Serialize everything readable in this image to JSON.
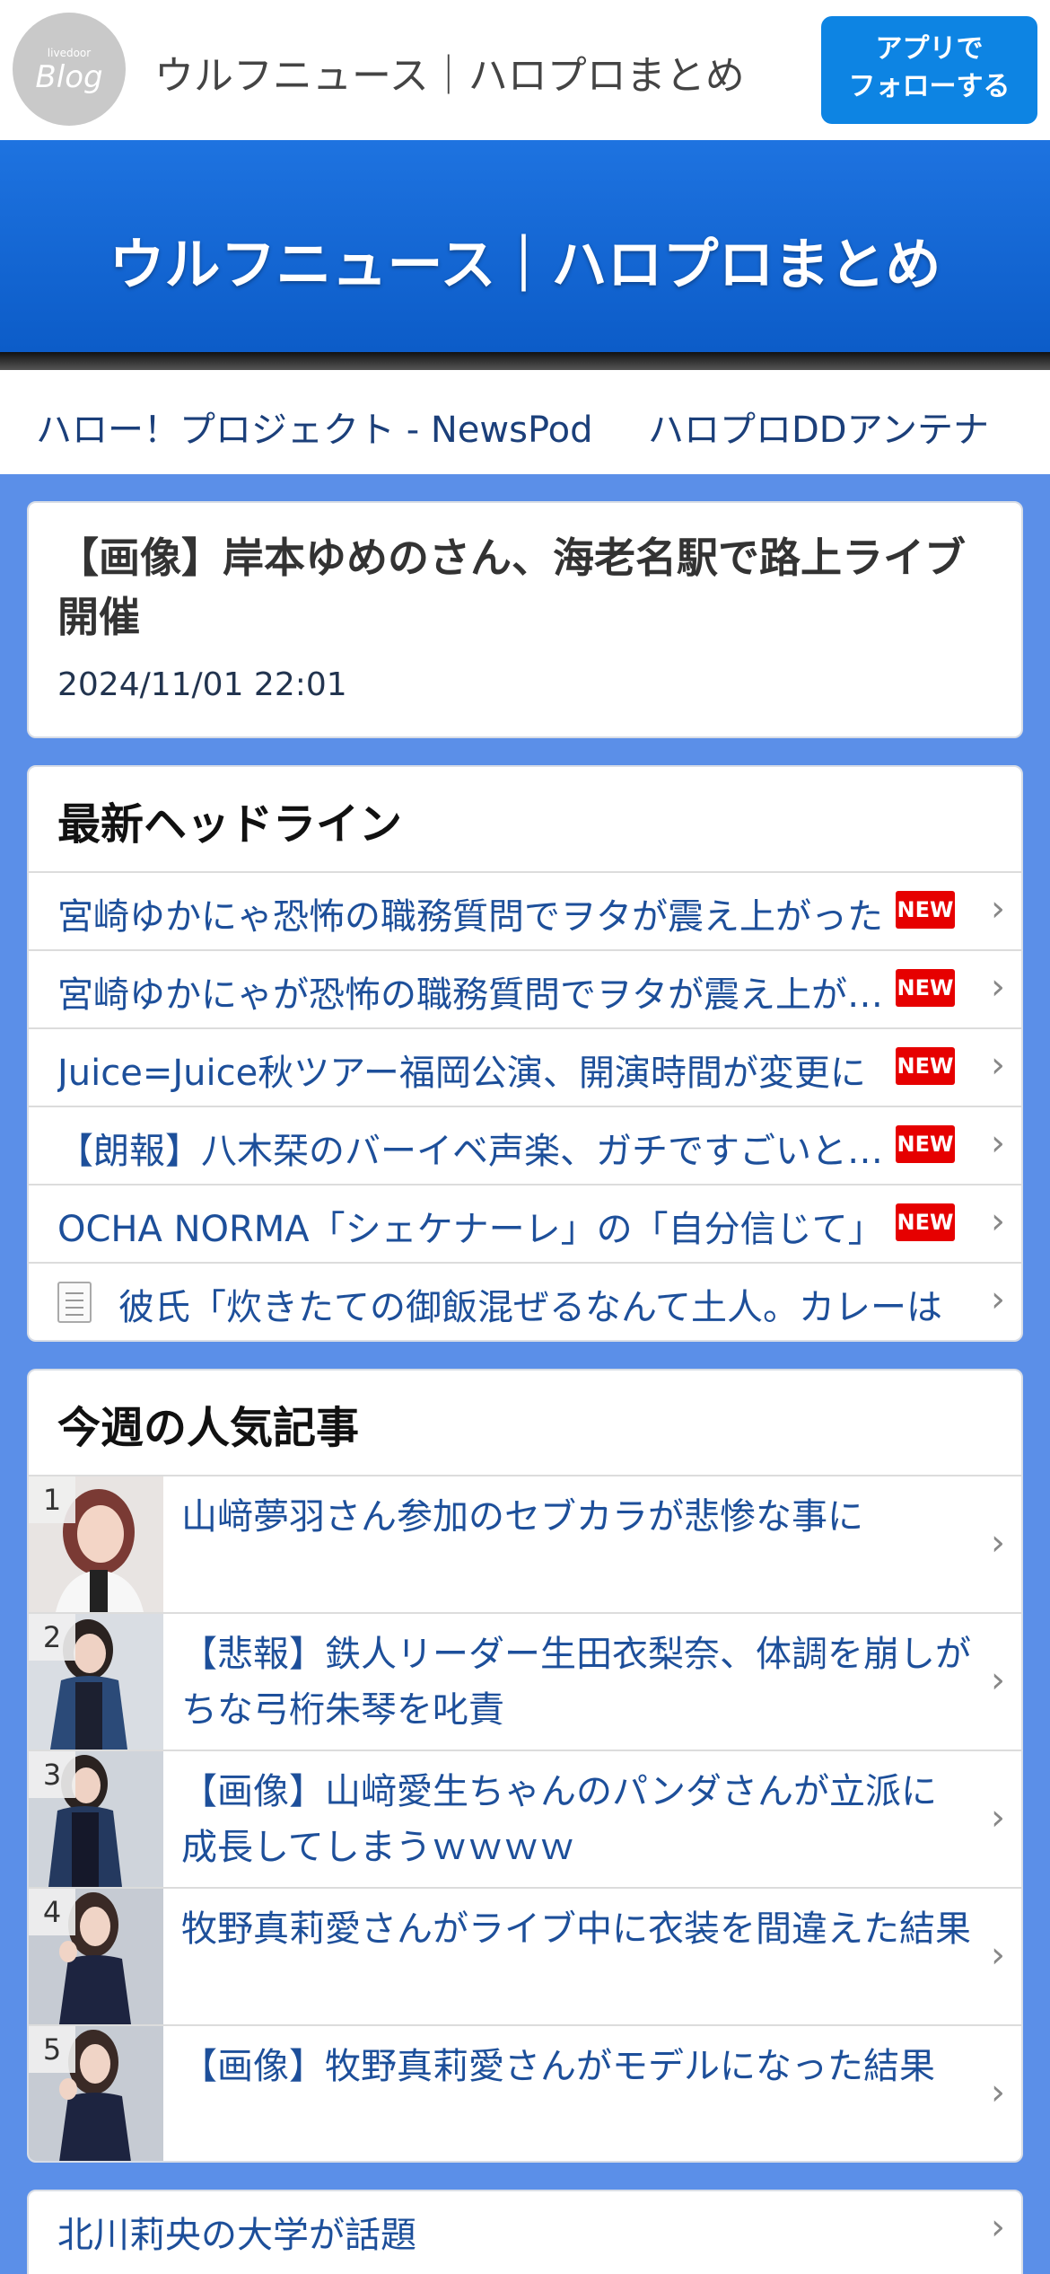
{
  "header": {
    "logo_small": "livedoor",
    "logo_big": "Blog",
    "site_name": "ウルフニュース｜ハロプロまとめ",
    "follow_button": "アプリで\nフォローする"
  },
  "banner": {
    "title": "ウルフニュース｜ハロプロまとめ"
  },
  "linkbar": {
    "links": [
      "ハロー！プロジェクト - NewsPod",
      "ハロプロDDアンテナ"
    ]
  },
  "article": {
    "title": "【画像】岸本ゆめのさん、海老名駅で路上ライブ開催",
    "date": "2024/11/01 22:01"
  },
  "headlines": {
    "heading": "最新ヘッドライン",
    "new_badge": "NEW",
    "items": [
      {
        "text": "宮崎ゆかにゃ恐怖の職務質問でヲタが震え上がった",
        "new": true
      },
      {
        "text": "宮崎ゆかにゃが恐怖の職務質問でヲタが震え上がった",
        "new": true
      },
      {
        "text": "Juice=Juice秋ツアー福岡公演、開演時間が変更に",
        "new": true
      },
      {
        "text": "【朗報】八木栞のバーイベ声楽、ガチですごいと話題",
        "new": true
      },
      {
        "text": "OCHA NORMA「シェケナーレ」の「自分信じて」",
        "new": true
      },
      {
        "text": "彼氏「炊きたての御飯混ぜるなんて土人。カレーは",
        "new": false,
        "icon": "document-icon"
      }
    ]
  },
  "ranking": {
    "heading": "今週の人気記事",
    "items": [
      {
        "rank": "1",
        "title": "山﨑夢羽さん参加のセブカラが悲惨な事に"
      },
      {
        "rank": "2",
        "title": "【悲報】鉄人リーダー生田衣梨奈、体調を崩しがちな弓桁朱琴を叱責"
      },
      {
        "rank": "3",
        "title": "【画像】山﨑愛生ちゃんのパンダさんが立派に成長してしまうｗｗｗｗ"
      },
      {
        "rank": "4",
        "title": "牧野真莉愛さんがライブ中に衣装を間違えた結果"
      },
      {
        "rank": "5",
        "title": "【画像】牧野真莉愛さんがモデルになった結果"
      }
    ]
  },
  "extra": {
    "link": "北川莉央の大学が話題"
  },
  "colors": {
    "page_bg": "#5b8fe8",
    "banner": "#1e73e0",
    "follow_button": "#0d84e3",
    "link_text": "#1d4f9a",
    "new_badge": "#e60000"
  }
}
